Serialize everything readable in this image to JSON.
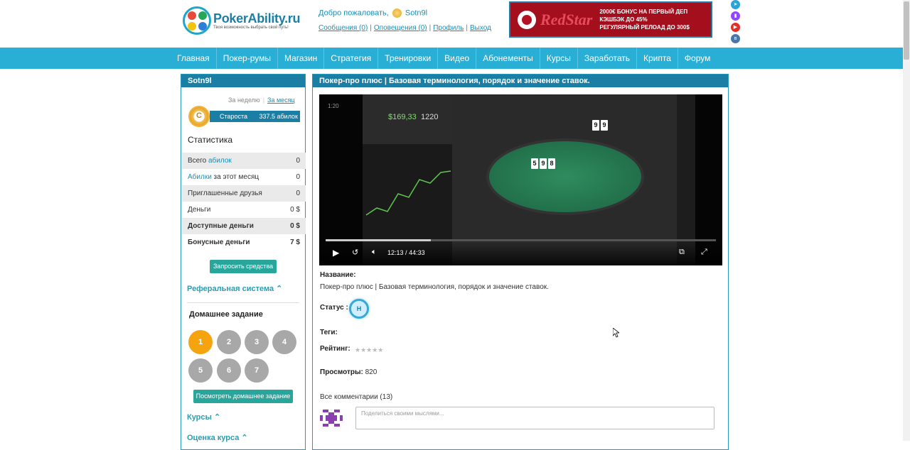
{
  "header": {
    "logo_title": "PokerAbility.ru",
    "logo_subtitle": "Твоя возможность выбрать свой путь!",
    "welcome_text": "Добро пожаловать,",
    "username": "Sotn9l",
    "links": [
      "Сообщения (0)",
      "Оповещения (0)",
      "Профиль",
      "Выход"
    ],
    "banner": {
      "brand": "RedStar",
      "line1": "2000€ БОНУС НА ПЕРВЫЙ ДЕП",
      "line2": "КЭШБЭК ДО 45%",
      "line3": "РЕГУЛЯРНЫЙ РЕЛОАД ДО 300$"
    },
    "social_icons": [
      "telegram-icon",
      "twitch-icon",
      "youtube-icon",
      "vk-icon"
    ]
  },
  "nav": {
    "items": [
      "Главная",
      "Покер-румы",
      "Магазин",
      "Стратегия",
      "Тренировки",
      "Видео",
      "Абонементы",
      "Курсы",
      "Заработать",
      "Крипта",
      "Форум"
    ]
  },
  "sidebar": {
    "username": "Sotn9l",
    "period_week": "За неделю",
    "period_month": "За месяц",
    "rank_letter": "C",
    "rank_name": "Староста",
    "rank_value": "337.5 абилок",
    "stats_title": "Статистика",
    "stats": [
      {
        "label_pre": "Всего ",
        "label_hl": "абилок",
        "label_post": "",
        "value": "0",
        "bold": false
      },
      {
        "label_pre": "",
        "label_hl": "Абилки",
        "label_post": " за этот месяц",
        "value": "0",
        "bold": false
      },
      {
        "label_pre": "Приглашенные друзья",
        "label_hl": "",
        "label_post": "",
        "value": "0",
        "bold": false
      },
      {
        "label_pre": "Деньги",
        "label_hl": "",
        "label_post": "",
        "value": "0 $",
        "bold": false
      },
      {
        "label_pre": "Доступные деньги",
        "label_hl": "",
        "label_post": "",
        "value": "0 $",
        "bold": true
      },
      {
        "label_pre": "Бонусные деньги",
        "label_hl": "",
        "label_post": "",
        "value": "7 $",
        "bold": true
      }
    ],
    "withdraw_button": "Запросить средства",
    "referral": "Реферальная система",
    "homework_title": "Домашнее задание",
    "homework_items": [
      "1",
      "2",
      "3",
      "4",
      "5",
      "6",
      "7"
    ],
    "homework_active": "1",
    "view_homework_button": "Посмотреть домашнее задание",
    "courses": "Курсы",
    "course_rating": "Оценка курса"
  },
  "main": {
    "title": "Покер-про плюс | Базовая терминология, порядок и значение ставок.",
    "video": {
      "current_time": "12:13",
      "separator": "/",
      "duration": "44:33",
      "played_fraction": 0.27,
      "corner_label": "1:20",
      "price_left": "$169,33",
      "price_right": "1220",
      "board_cards": [
        "5",
        "9",
        "8"
      ],
      "top_cards": [
        "9",
        "9"
      ]
    },
    "name_label": "Название:",
    "name_value": "Покер-про плюс | Базовая терминология, порядок и значение ставок.",
    "status_label": "Статус :",
    "status_badge": "H",
    "tags_label": "Теги:",
    "rating_label": "Рейтинг:",
    "rating_stars": "★★★★★",
    "views_label": "Просмотры:",
    "views_value": "820",
    "comments_title": "Все комментарии (13)",
    "comment_placeholder": "Поделиться своими мыслями..."
  },
  "colors": {
    "nav_bg": "#29aed6",
    "panel_header": "#1b7fa5",
    "teal_button": "#28a69c",
    "active_circle": "#f5a30f"
  }
}
